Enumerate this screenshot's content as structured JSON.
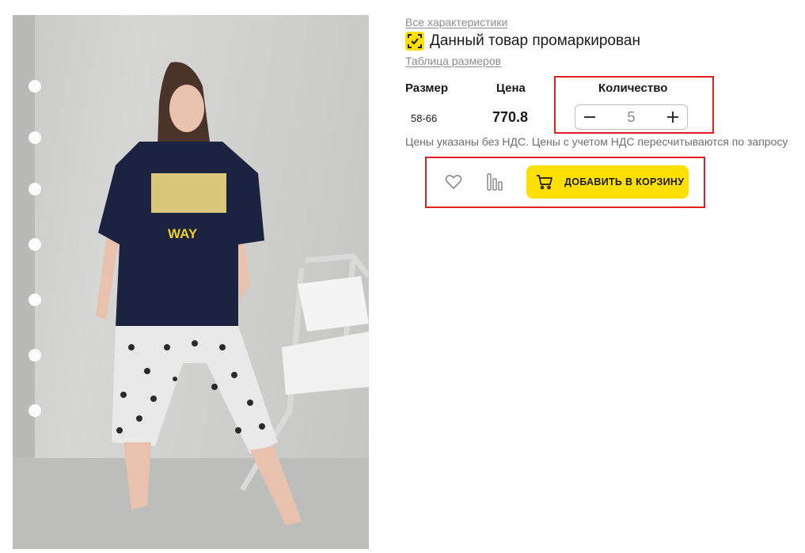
{
  "links": {
    "all_specs": "Все характеристики",
    "size_table": "Таблица размеров"
  },
  "marking": {
    "label": "Данный товар промаркирован",
    "icon": "data-matrix-icon",
    "color": "#ffe000"
  },
  "product_image": {
    "shirt_print": "WAY"
  },
  "table": {
    "size_header": "Размер",
    "price_header": "Цена",
    "qty_header": "Количество",
    "size_value": "58-66",
    "price_value": "770.8",
    "qty_value": "5"
  },
  "vat_note": "Цены указаны без НДС. Цены с учетом НДС пересчитываются по запросу",
  "actions": {
    "favorite_icon": "heart-icon",
    "compare_icon": "compare-bars-icon",
    "cart_icon": "cart-icon",
    "add_to_cart": "ДОБАВИТЬ В КОРЗИНУ"
  },
  "colors": {
    "accent": "#ffe000",
    "highlight": "#e02020"
  }
}
